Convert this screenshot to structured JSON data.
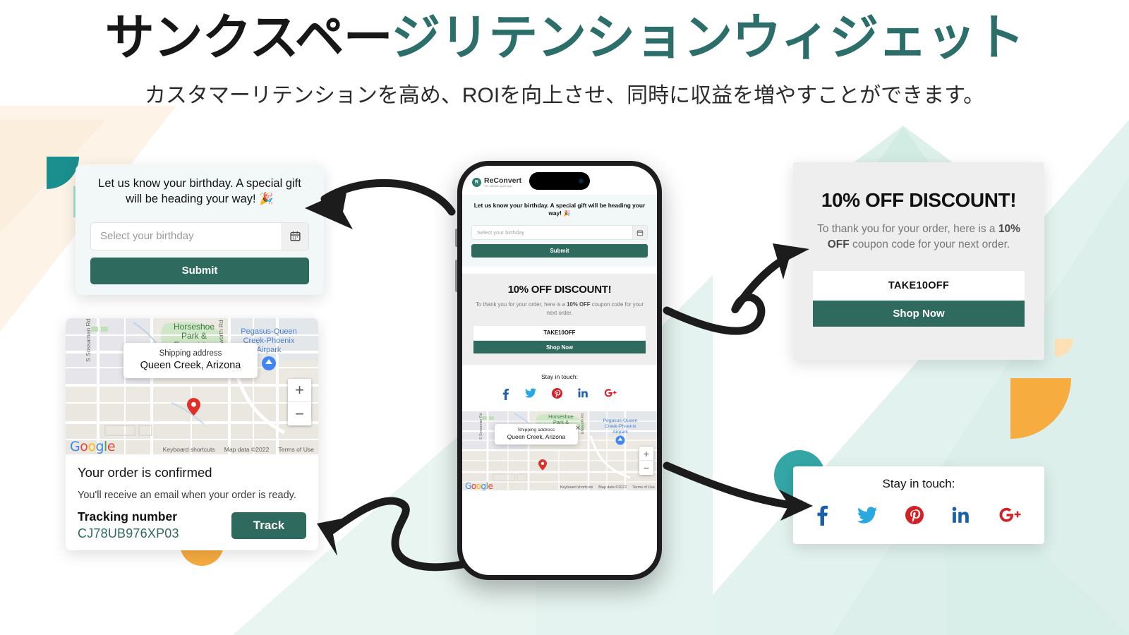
{
  "header": {
    "title_black": "サンクスペー",
    "title_accent": "ジリテンションウィジェット",
    "subtitle": "カスタマーリテンションを高め、ROIを向上させ、同時に収益を増やすことができます。"
  },
  "colors": {
    "accent_teal": "#2c6e69",
    "button_teal": "#2e6b5e",
    "deco_teal_dark": "#1b8e8e",
    "deco_mint": "#a9e0d1",
    "deco_orange": "#f7ac3f",
    "deco_teal_circle": "#35a6a6",
    "bg_mint": "#e4f3ef",
    "bg_cream": "#fdf2e3",
    "card_gray": "#eeeeee",
    "card_mint": "#f2f8f7"
  },
  "birthday_widget": {
    "message": "Let us know your birthday. A special gift will be heading your way! 🎉",
    "input_placeholder": "Select your birthday",
    "calendar_icon": "calendar-icon",
    "submit_label": "Submit"
  },
  "discount_widget": {
    "title": "10% OFF DISCOUNT!",
    "body_part1": "To thank you for your order, here is a ",
    "body_bold": "10% OFF",
    "body_part2": " coupon code for your next order.",
    "coupon_code": "TAKE10OFF",
    "shop_label": "Shop Now"
  },
  "order_widget": {
    "title": "Your order is confirmed",
    "subtitle": "You'll receive an email when your order is ready.",
    "tracking_label": "Tracking number",
    "tracking_number": "CJ78UB976XP03",
    "track_button": "Track"
  },
  "map": {
    "popup_label": "Shipping address",
    "popup_value": "Queen Creek, Arizona",
    "close_icon": "close-icon",
    "zoom_in": "+",
    "zoom_out": "−",
    "brand": "Google",
    "brand_letters": [
      "G",
      "o",
      "o",
      "g",
      "l",
      "e"
    ],
    "attribution": [
      "Keyboard shortcuts",
      "Map data ©2022",
      "Terms of Use"
    ],
    "labels": {
      "park": "Horseshoe Park & Equestrian Centre",
      "road_left": "S Sossaman Rd",
      "road_mid": "Ellsworth Rd",
      "airpark": "Pegasus-Queen Creek-Phoenix Airpark"
    }
  },
  "social_widget": {
    "title": "Stay in touch:",
    "icons": [
      {
        "name": "facebook-icon",
        "color": "#1b5faa"
      },
      {
        "name": "twitter-icon",
        "color": "#2aa9e0"
      },
      {
        "name": "pinterest-icon",
        "color": "#d32027"
      },
      {
        "name": "linkedin-icon",
        "color": "#1b5faa"
      },
      {
        "name": "googleplus-icon",
        "color": "#d32027"
      }
    ]
  },
  "phone": {
    "brand_name": "ReConvert",
    "brand_tagline": "The ultimate upsell App",
    "dynamic_island": "dynamic-island"
  }
}
